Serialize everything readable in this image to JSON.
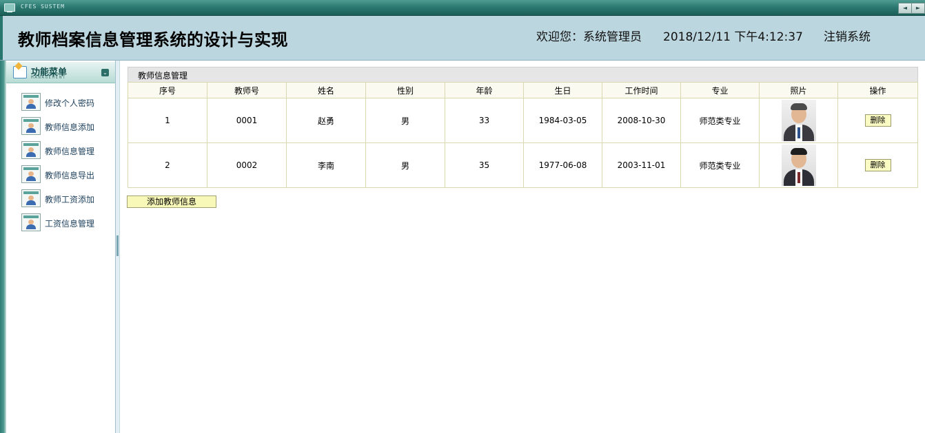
{
  "system": {
    "name": "CFES SUSTEM",
    "nav_prev": "◄",
    "nav_next": "►"
  },
  "header": {
    "title": "教师档案信息管理系统的设计与实现",
    "welcome": "欢迎您：系统管理员",
    "datetime": "2018/12/11 下午4:12:37",
    "logout": "注销系统"
  },
  "sidebar": {
    "title": "功能菜单",
    "subtitle": "MANAGEMENT",
    "items": [
      {
        "label": "修改个人密码"
      },
      {
        "label": "教师信息添加"
      },
      {
        "label": "教师信息管理"
      },
      {
        "label": "教师信息导出"
      },
      {
        "label": "教师工资添加"
      },
      {
        "label": "工资信息管理"
      }
    ]
  },
  "main": {
    "panel_title": "教师信息管理",
    "columns": [
      "序号",
      "教师号",
      "姓名",
      "性别",
      "年龄",
      "生日",
      "工作时间",
      "专业",
      "照片",
      "操作"
    ],
    "rows": [
      {
        "index": "1",
        "teacher_no": "0001",
        "name": "赵勇",
        "gender": "男",
        "age": "33",
        "birthday": "1984-03-05",
        "work_date": "2008-10-30",
        "major": "师范类专业",
        "action": "删除"
      },
      {
        "index": "2",
        "teacher_no": "0002",
        "name": "李南",
        "gender": "男",
        "age": "35",
        "birthday": "1977-06-08",
        "work_date": "2003-11-01",
        "major": "师范类专业",
        "action": "删除"
      }
    ],
    "add_button": "添加教师信息"
  },
  "colors": {
    "header_bg": "#bcd6df",
    "topbar": "#2c7a72",
    "button_bg": "#fbfbc4",
    "table_border": "#d8d8b0",
    "tie_1": "#2d4f8a",
    "tie_2": "#7a2a2a"
  }
}
